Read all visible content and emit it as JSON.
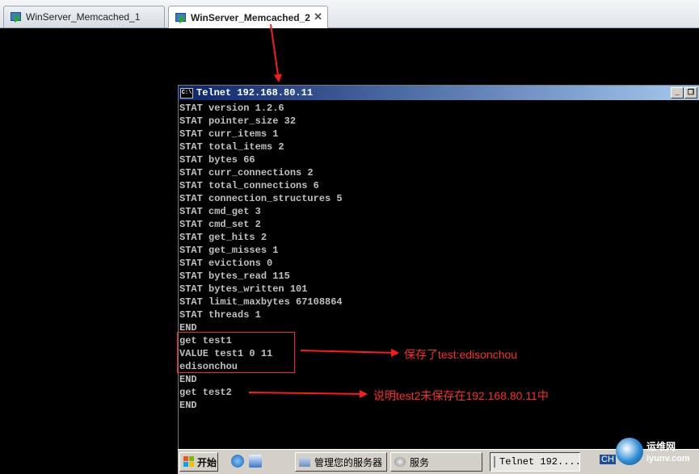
{
  "vm_tabs": [
    {
      "label": "WinServer_Memcached_1",
      "active": false
    },
    {
      "label": "WinServer_Memcached_2",
      "active": true,
      "close": "✕"
    }
  ],
  "telnet_window": {
    "title": "Telnet 192.168.80.11",
    "icon_label": "C:\\",
    "minimize": "_",
    "restore": "❐"
  },
  "terminal_lines": [
    "STAT version 1.2.6",
    "STAT pointer_size 32",
    "STAT curr_items 1",
    "STAT total_items 2",
    "STAT bytes 66",
    "STAT curr_connections 2",
    "STAT total_connections 6",
    "STAT connection_structures 5",
    "STAT cmd_get 3",
    "STAT cmd_set 2",
    "STAT get_hits 2",
    "STAT get_misses 1",
    "STAT evictions 0",
    "STAT bytes_read 115",
    "STAT bytes_written 101",
    "STAT limit_maxbytes 67108864",
    "STAT threads 1",
    "END",
    "get test1",
    "VALUE test1 0 11",
    "edisonchou",
    "END",
    "get test2",
    "END"
  ],
  "annotations": {
    "note1": "保存了test:edisonchou",
    "note2": "说明test2未保存在192.168.80.11中",
    "arrow_color": "#ff1a1a"
  },
  "taskbar": {
    "start_label": "开始",
    "tasks": [
      {
        "label": "管理您的服务器",
        "icon": "server-manager-icon"
      },
      {
        "label": "服务",
        "icon": "services-icon"
      },
      {
        "label": "Telnet 192....",
        "icon": "cmd-icon",
        "pressed": true
      }
    ],
    "tray_text": "CH"
  },
  "watermark": {
    "line1": "运维网",
    "line2": "iyunv.com"
  }
}
